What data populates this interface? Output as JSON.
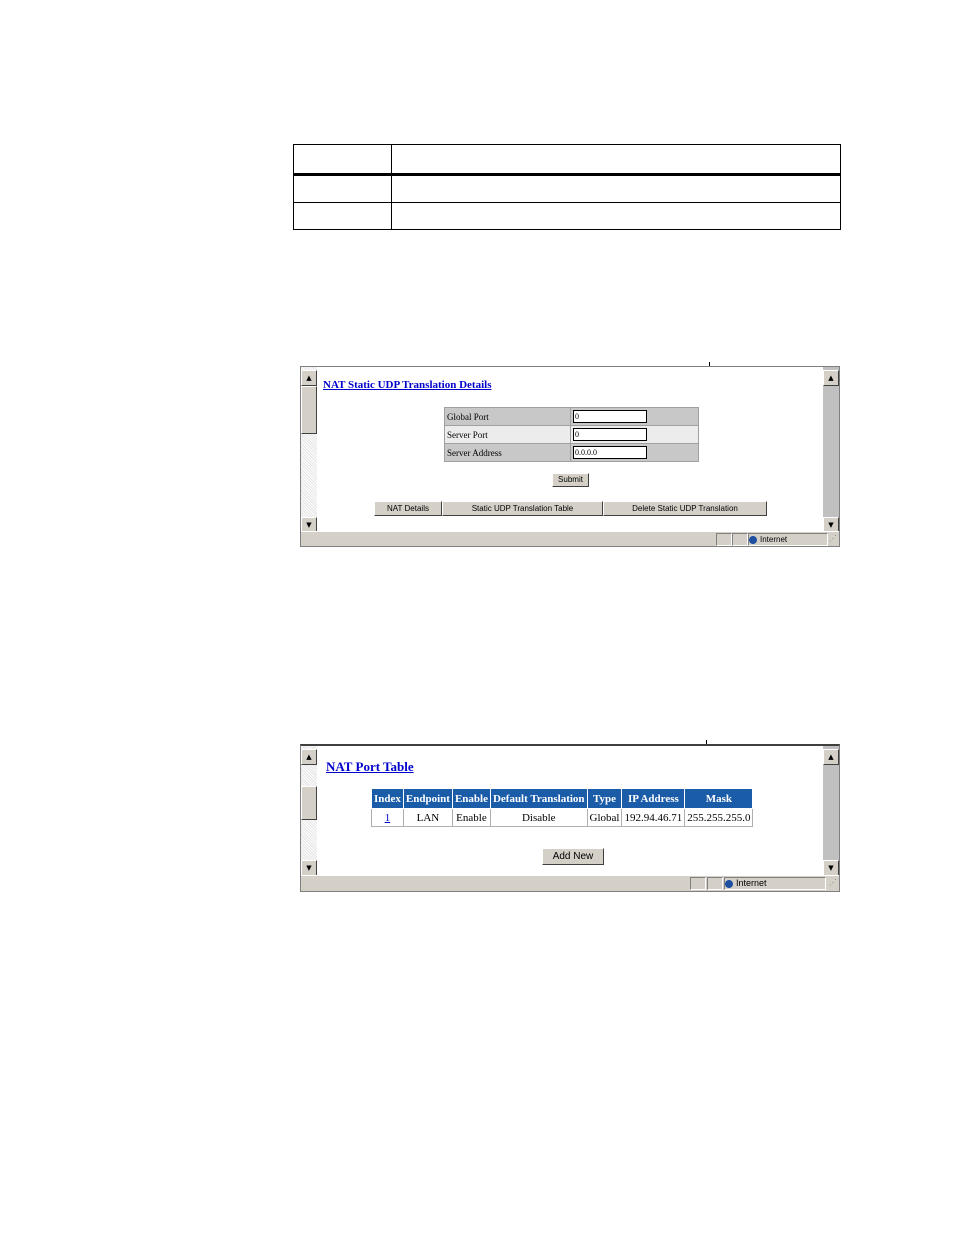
{
  "frame1": {
    "title": "NAT Static UDP Translation Details",
    "fields": [
      {
        "label": "Global Port",
        "value": "0"
      },
      {
        "label": "Server Port",
        "value": "0"
      },
      {
        "label": "Server Address",
        "value": "0.0.0.0"
      }
    ],
    "submit_label": "Submit",
    "nav": [
      "NAT Details",
      "Static UDP Translation Table",
      "Delete Static UDP Translation"
    ],
    "status_zone": "Internet"
  },
  "frame2": {
    "title": "NAT Port Table",
    "columns": [
      "Index",
      "Endpoint",
      "Enable",
      "Default Translation",
      "Type",
      "IP Address",
      "Mask"
    ],
    "rows": [
      {
        "index": "1",
        "endpoint": "LAN",
        "enable": "Enable",
        "default_translation": "Disable",
        "type": "Global",
        "ip_address": "192.94.46.71",
        "mask": "255.255.255.0"
      }
    ],
    "add_label": "Add New",
    "status_zone": "Internet"
  }
}
